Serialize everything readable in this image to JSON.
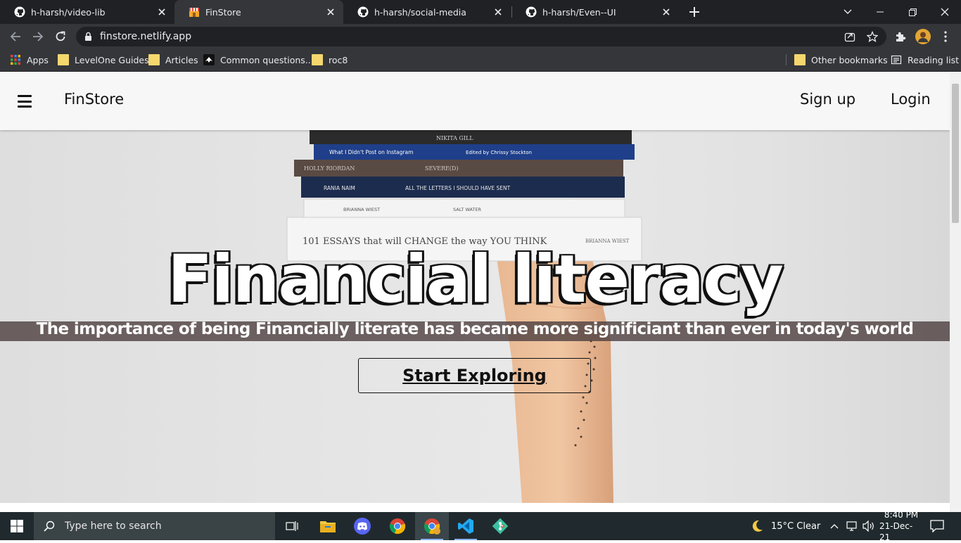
{
  "browser": {
    "tabs": [
      {
        "title": "h-harsh/video-lib",
        "icon": "github-icon",
        "active": false
      },
      {
        "title": "FinStore",
        "icon": "store-icon",
        "active": true
      },
      {
        "title": "h-harsh/social-media",
        "icon": "github-icon",
        "active": false
      },
      {
        "title": "h-harsh/Even--UI",
        "icon": "github-icon",
        "active": false
      }
    ],
    "url": "finstore.netlify.app",
    "bookmarks": [
      {
        "label": "Apps",
        "icon": "apps-grid-icon"
      },
      {
        "label": "LevelOne Guides",
        "icon": "folder-icon"
      },
      {
        "label": "Articles",
        "icon": "folder-icon"
      },
      {
        "label": "Common questions...",
        "icon": "bookmark-favicon-icon"
      },
      {
        "label": "roc8",
        "icon": "folder-icon"
      }
    ],
    "other_bookmarks": "Other bookmarks",
    "reading_list": "Reading list"
  },
  "site": {
    "brand": "FinStore",
    "signup": "Sign up",
    "login": "Login",
    "hero_title": "Financial literacy",
    "hero_subtitle": "The importance of being Financially literate has became more significiant than ever in today's world",
    "cta": "Start Exploring"
  },
  "books": [
    {
      "title": "NIKITA GILL",
      "color": "#2b2b2b"
    },
    {
      "title": "What I Didn't Post on Instagram",
      "author": "Edited by Chrissy Stockton",
      "color": "#1f3f8a"
    },
    {
      "title": "HOLLY RIORDAN",
      "subtitle": "SEVERE(D)",
      "color": "#5a4a44"
    },
    {
      "title": "RANIA NAIM",
      "subtitle": "ALL THE LETTERS I SHOULD HAVE SENT",
      "color": "#1c2c4e"
    },
    {
      "title": "BRIANNA WIEST",
      "subtitle": "SALT WATER",
      "color": "#f3f3f3"
    },
    {
      "title": "101 ESSAYS that will CHANGE the way YOU THINK",
      "author": "BRIANNA WIEST",
      "color": "#f5f5f5"
    }
  ],
  "taskbar": {
    "search_placeholder": "Type here to search",
    "weather": "15°C  Clear",
    "time": "8:40 PM",
    "date": "21-Dec-21"
  },
  "colors": {
    "tabstrip": "#202124",
    "toolbar": "#35363a",
    "navbar": "#f7f7f7",
    "hero_band": "#504242"
  }
}
